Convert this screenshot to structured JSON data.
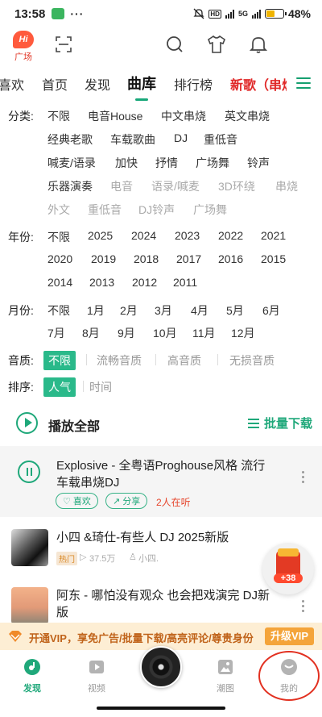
{
  "status_bar": {
    "time": "13:58",
    "dots": "···",
    "net1": "HD",
    "net2": "5G",
    "battery": "48%"
  },
  "header": {
    "logo_text": "Hi",
    "logo_label": "广场"
  },
  "tabs": [
    {
      "label": "喜欢"
    },
    {
      "label": "首页"
    },
    {
      "label": "发现"
    },
    {
      "label": "曲库"
    },
    {
      "label": "排行榜"
    },
    {
      "label": "新歌（串烧"
    }
  ],
  "filters": {
    "category_label": "分类:",
    "category_rows": [
      [
        "不限",
        "电音House",
        "中文串烧",
        "英文串烧"
      ],
      [
        "经典老歌",
        "车载歌曲",
        "DJ",
        "重低音"
      ],
      [
        "喊麦/语录",
        "加快",
        "抒情",
        "广场舞",
        "铃声"
      ],
      [
        "乐器演奏",
        "电音",
        "语录/喊麦",
        "3D环绕",
        "串烧"
      ],
      [
        "外文",
        "重低音",
        "DJ铃声",
        "广场舞"
      ]
    ],
    "year_label": "年份:",
    "year_rows": [
      [
        "不限",
        "2025",
        "2024",
        "2023",
        "2022",
        "2021"
      ],
      [
        "2020",
        "2019",
        "2018",
        "2017",
        "2016",
        "2015"
      ],
      [
        "2014",
        "2013",
        "2012",
        "2011"
      ]
    ],
    "month_label": "月份:",
    "month_rows": [
      [
        "不限",
        "1月",
        "2月",
        "3月",
        "4月",
        "5月",
        "6月"
      ],
      [
        "7月",
        "8月",
        "9月",
        "10月",
        "11月",
        "12月"
      ]
    ],
    "quality_label": "音质:",
    "quality_options": [
      "不限",
      "流畅音质",
      "高音质",
      "无损音质"
    ],
    "sort_label": "排序:",
    "sort_options": [
      "人气",
      "时间"
    ]
  },
  "play_all": {
    "label": "播放全部",
    "batch_label": "批量下载"
  },
  "songs": [
    {
      "title_line1": "Explosive - 全粤语Proghouse风格 流行",
      "title_line2": "车载串烧DJ",
      "like_label": "喜欢",
      "share_label": "分享",
      "listeners": "2人在听"
    },
    {
      "title": "小四 &琦仕-有些人 DJ 2025新版",
      "tag": "热门",
      "plays": "37.5万",
      "uploader": "小四."
    },
    {
      "title_line1": "阿东 - 哪怕没有观众 也会把戏演完 DJ新",
      "title_line2": "版"
    }
  ],
  "redpacket": {
    "amount": "+38"
  },
  "vip_banner": {
    "text": "开通VIP，享免广告/批量下载/高亮评论/尊贵身份",
    "button": "升级VIP"
  },
  "bottom_nav": [
    {
      "label": "发现"
    },
    {
      "label": "视频"
    },
    {
      "label": "潮图"
    },
    {
      "label": "我的"
    }
  ],
  "colors": {
    "accent": "#1fa87a",
    "red": "#e02828",
    "vip_orange": "#f4a43a"
  }
}
